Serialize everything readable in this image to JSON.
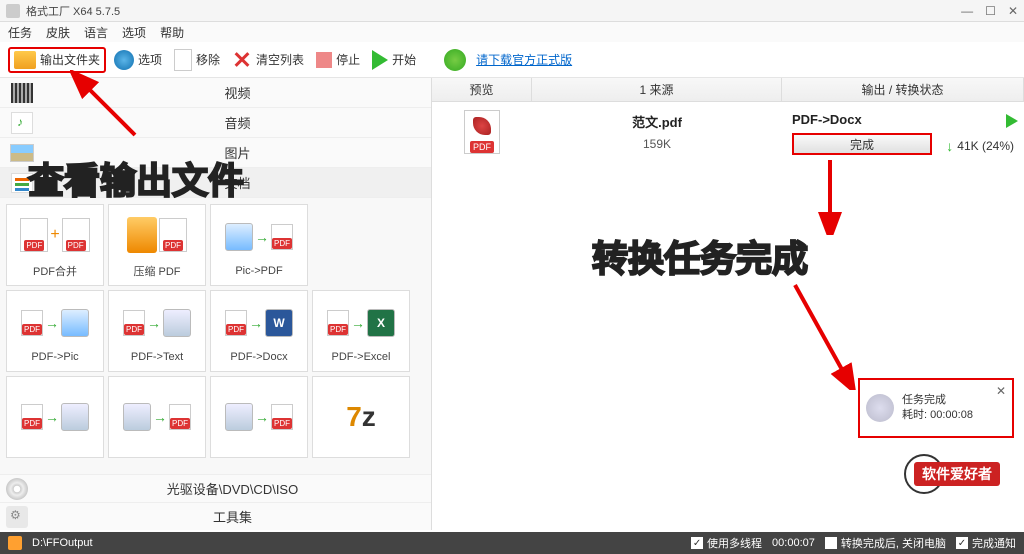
{
  "titlebar": {
    "title": "格式工厂 X64 5.7.5"
  },
  "menu": {
    "task": "任务",
    "skin": "皮肤",
    "lang": "语言",
    "option": "选项",
    "help": "帮助"
  },
  "toolbar": {
    "output_folder": "输出文件夹",
    "options": "选项",
    "remove": "移除",
    "clear_list": "清空列表",
    "stop": "停止",
    "start": "开始",
    "download_link": "请下载官方正式版"
  },
  "categories": {
    "video": "视频",
    "audio": "音频",
    "image": "图片",
    "document": "文档",
    "dvd": "光驱设备\\DVD\\CD\\ISO",
    "toolset": "工具集"
  },
  "tools": {
    "pdf_merge": "PDF合并",
    "compress_pdf": "压缩 PDF",
    "pic_to_pdf": "Pic->PDF",
    "pdf_to_pic": "PDF->Pic",
    "pdf_to_text": "PDF->Text",
    "pdf_to_docx": "PDF->Docx",
    "pdf_to_excel": "PDF->Excel"
  },
  "right": {
    "col_preview": "预览",
    "col_source": "1 来源",
    "col_status": "输出 / 转换状态",
    "task": {
      "filename": "范文.pdf",
      "filesize": "159K",
      "conversion": "PDF->Docx",
      "done": "完成",
      "outsize": "41K (24%)"
    },
    "notify": {
      "title": "任务完成",
      "elapsed": "耗时: 00:00:08"
    }
  },
  "statusbar": {
    "path": "D:\\FFOutput",
    "multithread": "使用多线程",
    "time": "00:00:07",
    "shutdown": "转换完成后, 关闭电脑",
    "notify": "完成通知"
  },
  "annotations": {
    "a1": "查看输出文件",
    "a2": "转换任务完成"
  },
  "watermark": "软件爱好者"
}
